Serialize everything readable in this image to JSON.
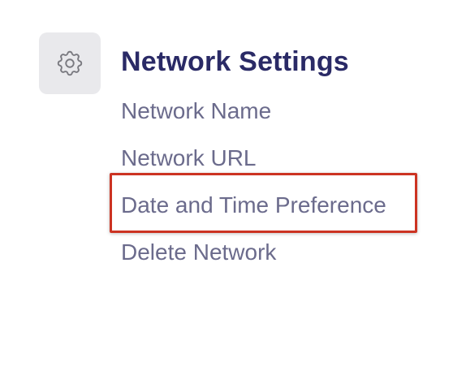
{
  "settings_panel": {
    "icon": "gear-icon",
    "title": "Network Settings",
    "menu_items": [
      {
        "label": "Network Name"
      },
      {
        "label": "Network URL"
      },
      {
        "label": "Date and Time Preference",
        "highlighted": true
      },
      {
        "label": "Delete Network"
      }
    ]
  },
  "colors": {
    "title": "#2a2a66",
    "menu_text": "#6b6b8c",
    "icon_tile": "#e9e9ec",
    "highlight_border": "#cc3322"
  }
}
